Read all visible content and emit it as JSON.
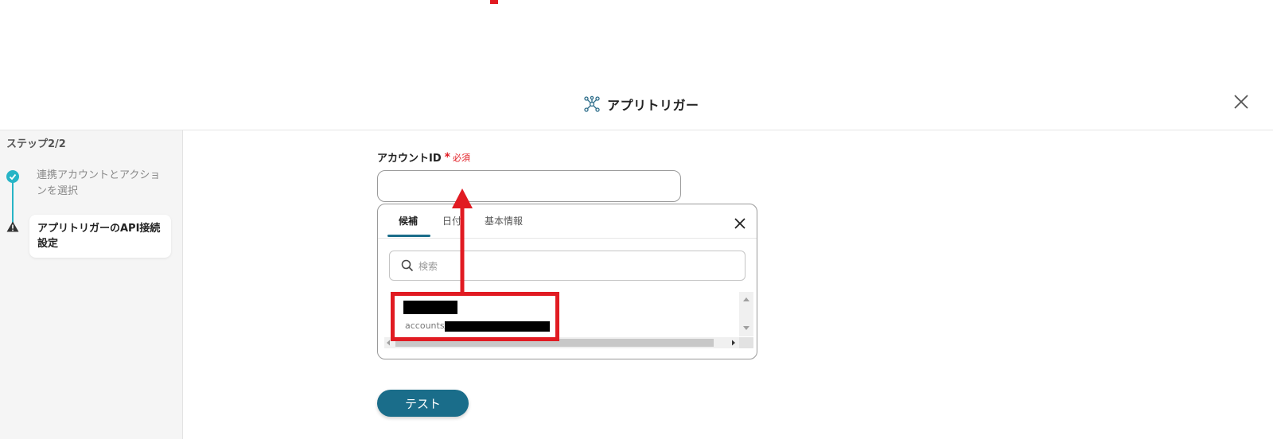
{
  "header": {
    "title": "アプリトリガー",
    "icon": "network-icon"
  },
  "sidebar": {
    "step_count": "ステップ2/2",
    "steps": [
      {
        "label": "連携アカウントとアクションを選択",
        "status": "complete"
      },
      {
        "label": "アプリトリガーのAPI接続設定",
        "status": "warning"
      }
    ]
  },
  "form": {
    "field_label": "アカウントID",
    "required_star": "*",
    "required_text": "必須",
    "input_value": ""
  },
  "popup": {
    "tabs": [
      {
        "label": "候補",
        "active": true
      },
      {
        "label": "日付",
        "active": false
      },
      {
        "label": "基本情報",
        "active": false
      }
    ],
    "search_placeholder": "検索",
    "item_sub_prefix": "accounts/"
  },
  "test_button": "テスト",
  "colors": {
    "accent": "#1a6d8a",
    "step_teal": "#27b4c6",
    "annotation_red": "#e11b22"
  }
}
